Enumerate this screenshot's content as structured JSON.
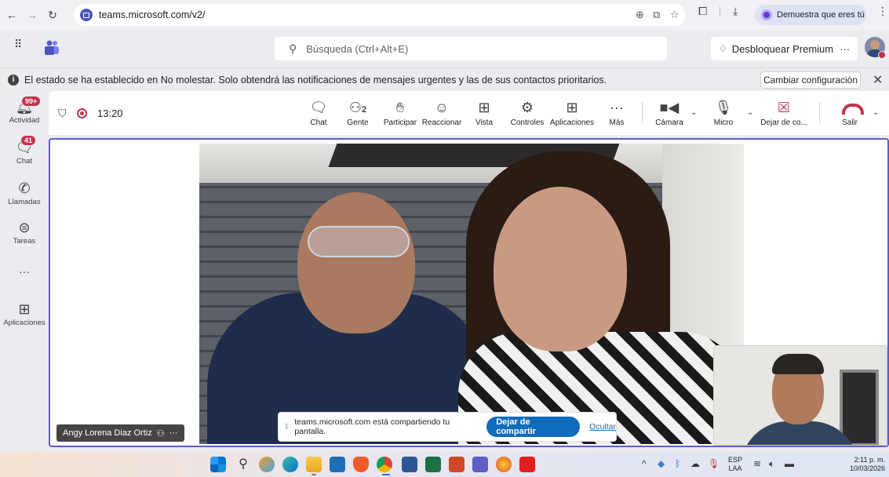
{
  "browser": {
    "url": "teams.microsoft.com/v2/",
    "profile_label": "Demuestra que eres tú",
    "icons": [
      "back-icon",
      "forward-icon",
      "reload-icon",
      "zoom-icon",
      "cast-icon",
      "star-icon",
      "extensions-icon",
      "download-icon",
      "menu-icon"
    ]
  },
  "teams": {
    "search_placeholder": "Búsqueda (Ctrl+Alt+E)",
    "premium_label": "Desbloquear Premium",
    "premium_more": "···"
  },
  "notification": {
    "text": "El estado se ha establecido en No molestar. Solo obtendrá las notificaciones de mensajes urgentes y las de sus contactos prioritarios.",
    "button": "Cambiar configuración"
  },
  "rail": [
    {
      "label": "Actividad",
      "badge": "99+"
    },
    {
      "label": "Chat",
      "badge": "41"
    },
    {
      "label": "Llamadas",
      "badge": ""
    },
    {
      "label": "Tareas",
      "badge": ""
    },
    {
      "label": "···",
      "badge": ""
    },
    {
      "label": "Aplicaciones",
      "badge": ""
    }
  ],
  "meeting": {
    "timer": "13:20",
    "people_count": "2",
    "toolbar": {
      "chat": "Chat",
      "people": "Gente",
      "raise": "Participar",
      "react": "Reaccionar",
      "view": "Vista",
      "controls": "Controles",
      "apps": "Aplicaciones",
      "more": "Más",
      "more_dots": "···",
      "camera": "Cámara",
      "mic": "Micro",
      "stop_share": "Dejar de co...",
      "leave": "Salir"
    }
  },
  "stage": {
    "participant_name": "Angy Lorena Diaz Ortiz",
    "participant_more": "···",
    "share_text": "teams.microsoft.com está compartiendo tu pantalla.",
    "share_stop": "Dejar de compartir",
    "share_hide": "Ocultar"
  },
  "taskbar": {
    "lang_top": "ESP",
    "lang_bottom": "LAA",
    "time": "2:11 p. m.",
    "date": "10/03/2026"
  }
}
